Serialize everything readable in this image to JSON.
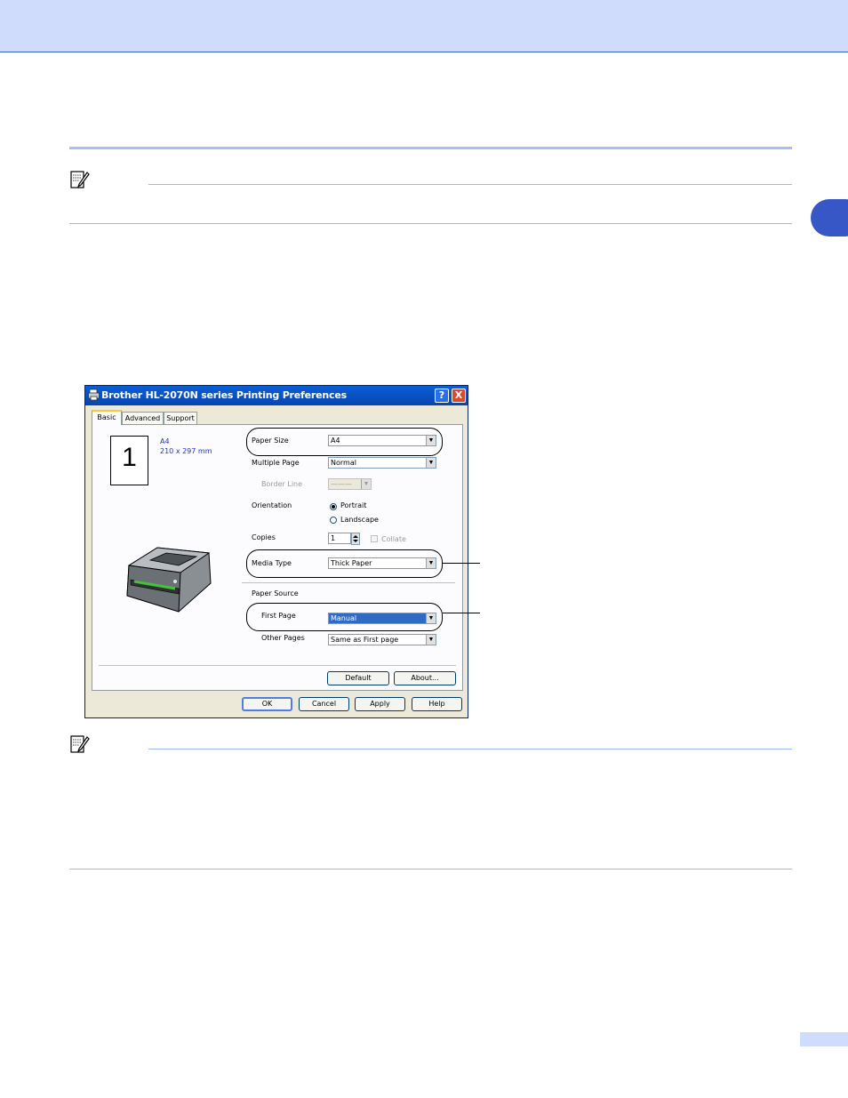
{
  "dialog": {
    "title": "Brother HL-2070N series Printing Preferences",
    "help_button": "?",
    "close_button": "X",
    "tabs": [
      "Basic",
      "Advanced",
      "Support"
    ],
    "preview": {
      "page_number": "1",
      "paper_name": "A4",
      "paper_dimensions": "210 x 297 mm"
    },
    "fields": {
      "paper_size": {
        "label": "Paper Size",
        "value": "A4"
      },
      "multiple_page": {
        "label": "Multiple Page",
        "value": "Normal"
      },
      "border_line": {
        "label": "Border Line",
        "value": "———"
      },
      "orientation": {
        "label": "Orientation",
        "options": [
          "Portrait",
          "Landscape"
        ],
        "selected": "Portrait"
      },
      "copies": {
        "label": "Copies",
        "value": "1"
      },
      "collate": {
        "label": "Collate",
        "checked": false
      },
      "media_type": {
        "label": "Media Type",
        "value": "Thick Paper"
      },
      "paper_source": {
        "label": "Paper Source"
      },
      "first_page": {
        "label": "First Page",
        "value": "Manual"
      },
      "other_pages": {
        "label": "Other Pages",
        "value": "Same as First page"
      }
    },
    "buttons": {
      "default": "Default",
      "about": "About...",
      "ok": "OK",
      "cancel": "Cancel",
      "apply": "Apply",
      "help": "Help"
    },
    "arrow_glyph": "▼",
    "colors": {
      "titlebar": "#0a5fd8",
      "selection": "#316ac5",
      "dialog_face": "#ece9d8"
    }
  },
  "page": {
    "header_color": "#cfdcfb",
    "accent": "#3757c6"
  },
  "icons": {
    "note": "note-pencil-icon",
    "printer": "printer-icon",
    "app": "printer-app-icon"
  }
}
